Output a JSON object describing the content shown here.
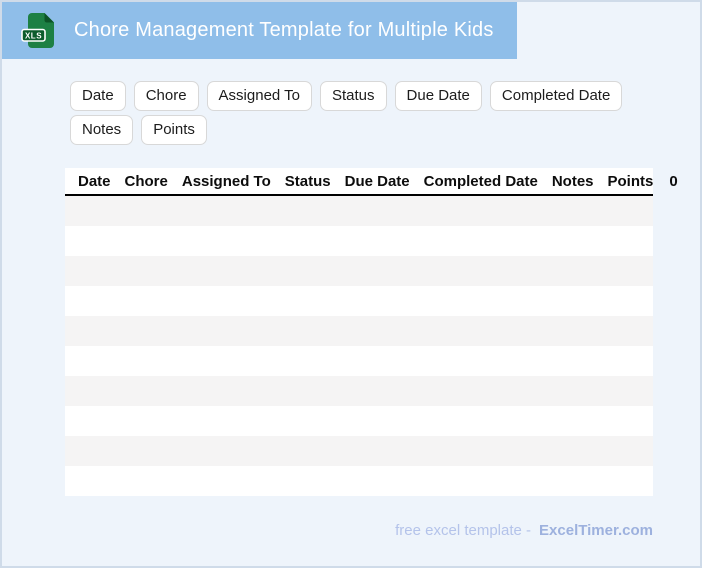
{
  "header": {
    "title": "Chore Management Template for Multiple Kids",
    "banner_color": "#8fbee9",
    "icon": {
      "label": "XLS",
      "body_color": "#1d8044",
      "fold_color": "#0c5427",
      "badge_color": "#0c5c2c"
    }
  },
  "chips": [
    "Date",
    "Chore",
    "Assigned To",
    "Status",
    "Due Date",
    "Completed Date",
    "Notes",
    "Points"
  ],
  "table": {
    "columns": [
      "Date",
      "Chore",
      "Assigned To",
      "Status",
      "Due Date",
      "Completed Date",
      "Notes",
      "Points",
      "0"
    ],
    "rows": 10,
    "stripe_color": "#f5f4f4"
  },
  "footer": {
    "prefix": "free excel template -",
    "brand": "ExcelTimer.com"
  },
  "colors": {
    "page_background": "#eef4fb",
    "page_border": "#cfdbe9",
    "banner": "#8fbee9",
    "header_underline": "#000000"
  }
}
